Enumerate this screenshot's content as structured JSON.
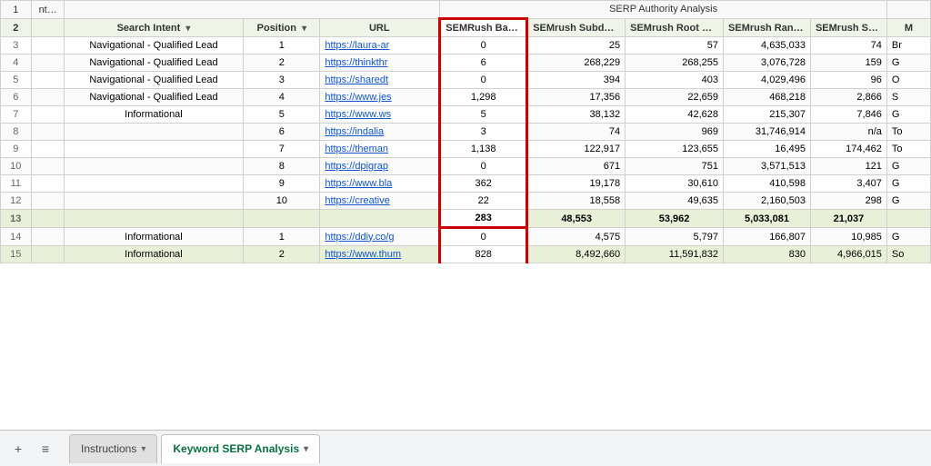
{
  "title": "SERP Authority Analysis",
  "sections": {
    "row1_left": "nt Analysis",
    "row1_center": "SERP Authority Analysis"
  },
  "columns": {
    "row_num": "#",
    "search_intent": "Search Intent",
    "position": "Position",
    "url": "URL",
    "semrush_backlinks": "SEMRush Backlinks",
    "semrush_subdomain_backlinks": "SEMrush Subdomain Backlinks",
    "semrush_root_domain_backlinks": "SEMrush Root Domain Backlinks",
    "semrush_rank": "SEMrush Rank",
    "semrush_se_traffic": "SEMrush SE Traffic",
    "col_m": "M"
  },
  "rows": [
    {
      "num": "3",
      "search_intent": "Navigational - Qualified Lead",
      "position": "1",
      "url": "https://laura-ar",
      "backlinks": "0",
      "subdomain_backlinks": "25",
      "root_domain_backlinks": "57",
      "rank": "4,635,033",
      "se_traffic": "74",
      "col_m": "Br"
    },
    {
      "num": "4",
      "search_intent": "Navigational - Qualified Lead",
      "position": "2",
      "url": "https://thinkthr",
      "backlinks": "6",
      "subdomain_backlinks": "268,229",
      "root_domain_backlinks": "268,255",
      "rank": "3,076,728",
      "se_traffic": "159",
      "col_m": "G"
    },
    {
      "num": "5",
      "search_intent": "Navigational - Qualified Lead",
      "position": "3",
      "url": "https://sharedt",
      "backlinks": "0",
      "subdomain_backlinks": "394",
      "root_domain_backlinks": "403",
      "rank": "4,029,496",
      "se_traffic": "96",
      "col_m": "O"
    },
    {
      "num": "6",
      "search_intent": "Navigational - Qualified Lead",
      "position": "4",
      "url": "https://www.jes",
      "backlinks": "1,298",
      "subdomain_backlinks": "17,356",
      "root_domain_backlinks": "22,659",
      "rank": "468,218",
      "se_traffic": "2,866",
      "col_m": "S"
    },
    {
      "num": "7",
      "search_intent": "Informational",
      "position": "5",
      "url": "https://www.ws",
      "backlinks": "5",
      "subdomain_backlinks": "38,132",
      "root_domain_backlinks": "42,628",
      "rank": "215,307",
      "se_traffic": "7,846",
      "col_m": "G"
    },
    {
      "num": "8",
      "search_intent": "",
      "position": "6",
      "url": "https://indalia",
      "backlinks": "3",
      "subdomain_backlinks": "74",
      "root_domain_backlinks": "969",
      "rank": "31,746,914",
      "se_traffic": "n/a",
      "col_m": "To"
    },
    {
      "num": "9",
      "search_intent": "",
      "position": "7",
      "url": "https://theman",
      "backlinks": "1,138",
      "subdomain_backlinks": "122,917",
      "root_domain_backlinks": "123,655",
      "rank": "16,495",
      "se_traffic": "174,462",
      "col_m": "To"
    },
    {
      "num": "10",
      "search_intent": "",
      "position": "8",
      "url": "https://dpigrap",
      "backlinks": "0",
      "subdomain_backlinks": "671",
      "root_domain_backlinks": "751",
      "rank": "3,571,513",
      "se_traffic": "121",
      "col_m": "G"
    },
    {
      "num": "11",
      "search_intent": "",
      "position": "9",
      "url": "https://www.bla",
      "backlinks": "362",
      "subdomain_backlinks": "19,178",
      "root_domain_backlinks": "30,610",
      "rank": "410,598",
      "se_traffic": "3,407",
      "col_m": "G"
    },
    {
      "num": "12",
      "search_intent": "",
      "position": "10",
      "url": "https://creative",
      "backlinks": "22",
      "subdomain_backlinks": "18,558",
      "root_domain_backlinks": "49,635",
      "rank": "2,160,503",
      "se_traffic": "298",
      "col_m": "G"
    },
    {
      "num": "13",
      "is_summary": true,
      "search_intent": "",
      "position": "",
      "url": "",
      "backlinks": "283",
      "subdomain_backlinks": "48,553",
      "root_domain_backlinks": "53,962",
      "rank": "5,033,081",
      "se_traffic": "21,037",
      "col_m": ""
    },
    {
      "num": "14",
      "search_intent": "Informational",
      "position": "1",
      "url": "https://ddiy.co/g",
      "backlinks": "0",
      "subdomain_backlinks": "4,575",
      "root_domain_backlinks": "5,797",
      "rank": "166,807",
      "se_traffic": "10,985",
      "col_m": "G"
    },
    {
      "num": "15",
      "search_intent": "Informational",
      "position": "2",
      "url": "https://www.thum",
      "backlinks": "828",
      "subdomain_backlinks": "8,492,660",
      "root_domain_backlinks": "11,591,832",
      "rank": "830",
      "se_traffic": "4,966,015",
      "col_m": "So"
    }
  ],
  "tabs": {
    "instructions": "Instructions",
    "keyword_serp": "Keyword SERP Analysis"
  },
  "icons": {
    "plus": "+",
    "list": "≡",
    "dropdown": "▾"
  }
}
